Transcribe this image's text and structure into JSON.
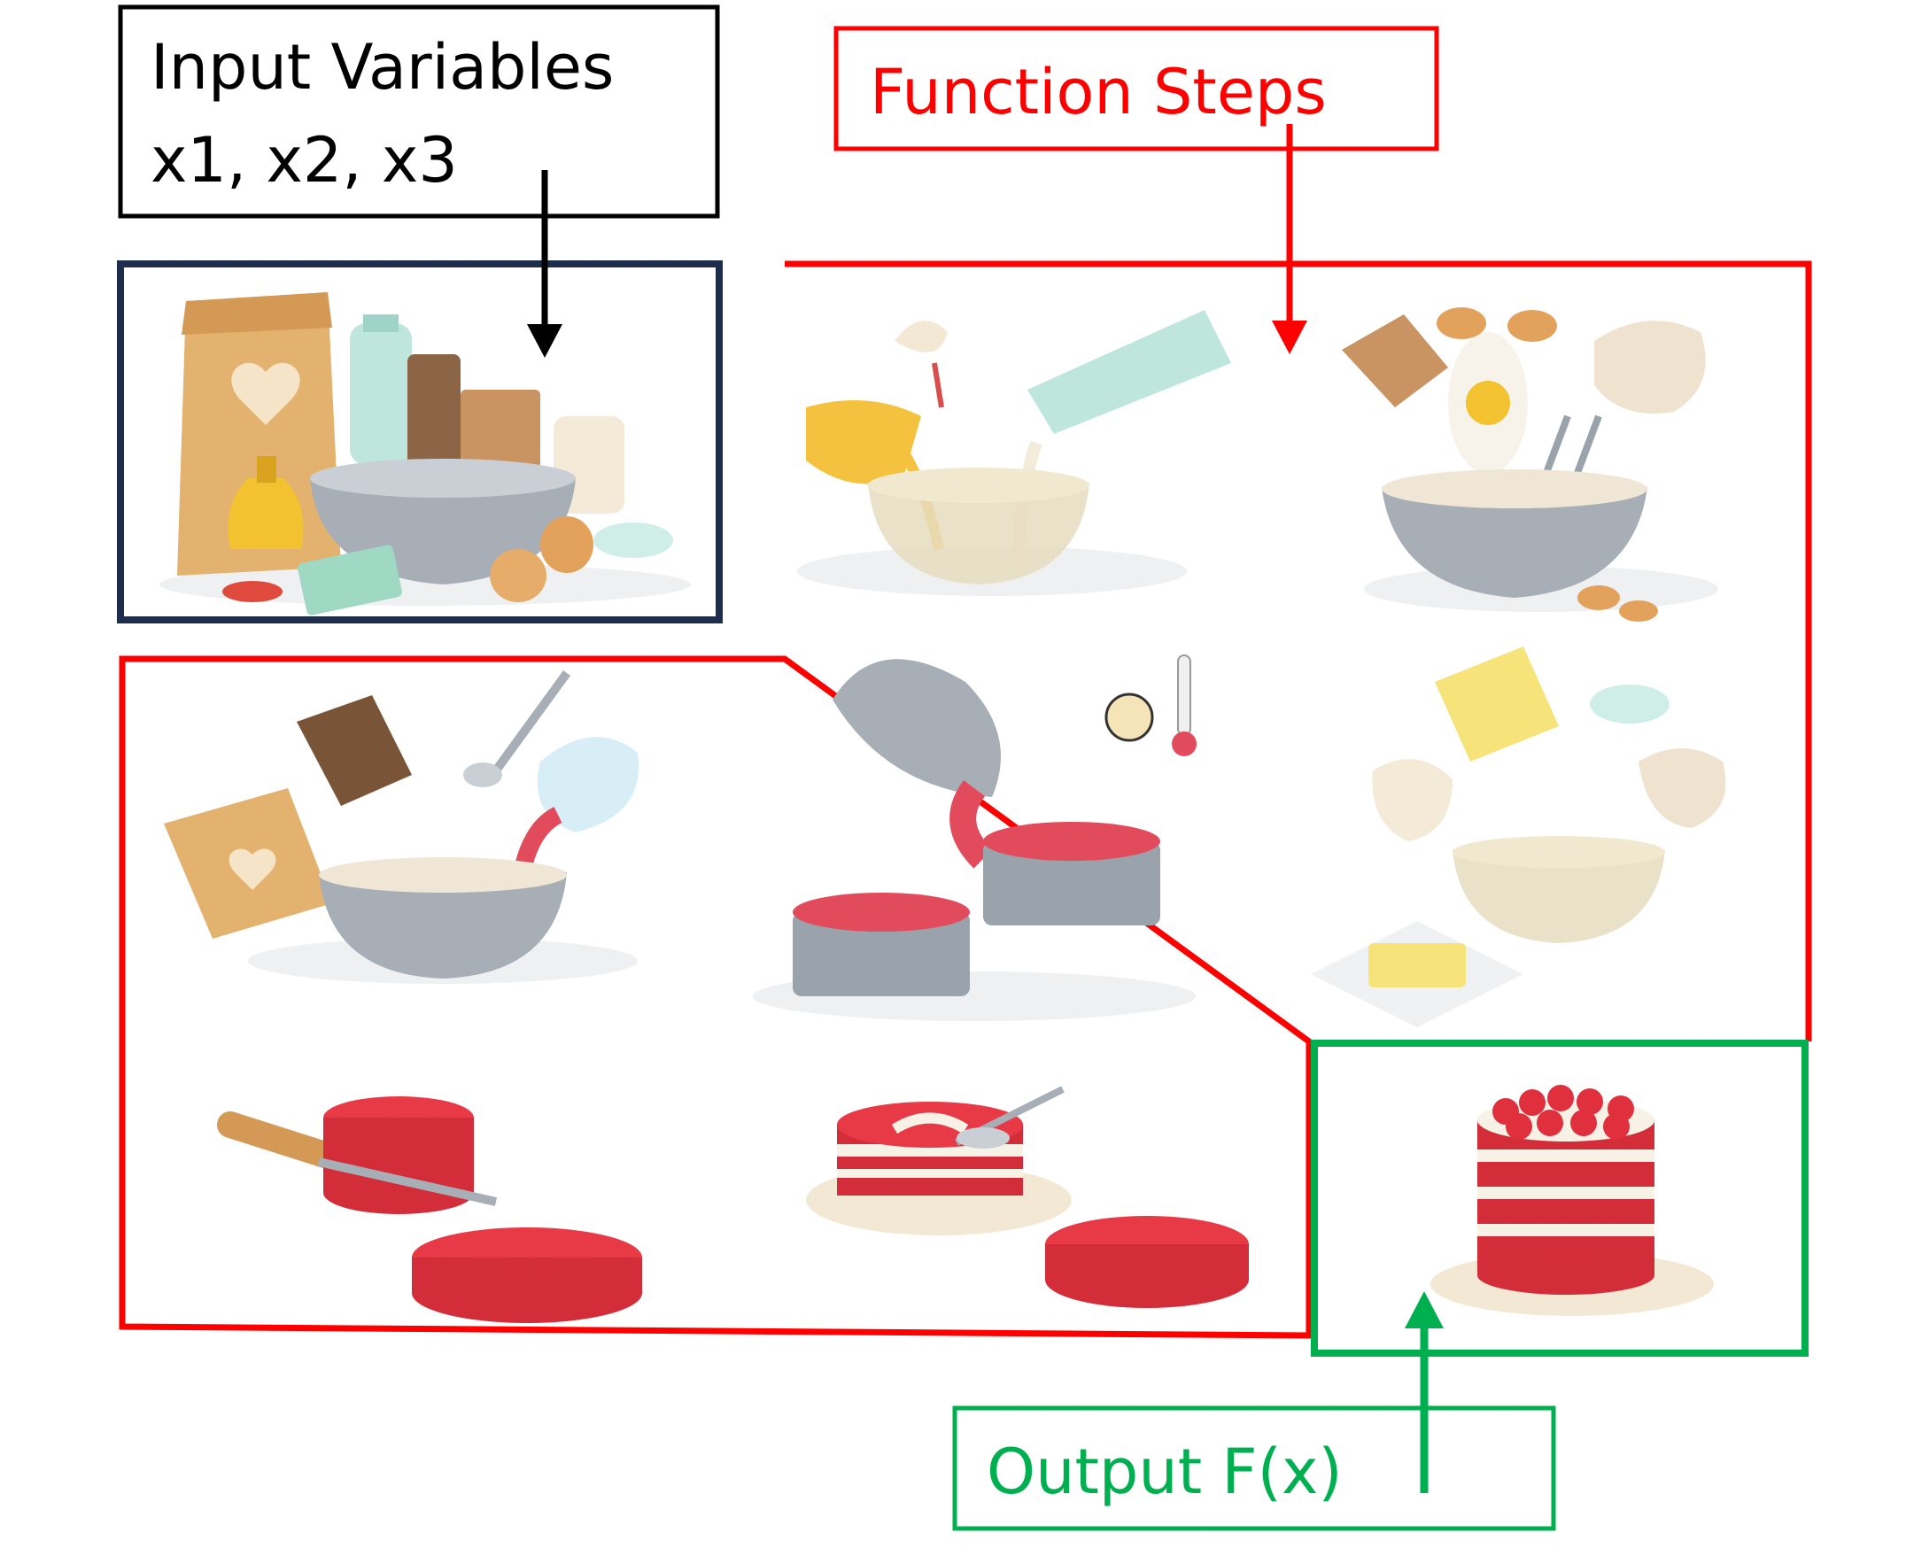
{
  "labels": {
    "input_line1": "Input Variables",
    "input_line2": "x1, x2, x3",
    "function": "Function Steps",
    "output": "Output F(x)"
  },
  "colors": {
    "input": "#000000",
    "ingredients_frame": "#1f2d4d",
    "function": "#ff0000",
    "output": "#00b050"
  },
  "icons": [
    "ingredients-illustration",
    "mix-liquids-illustration",
    "eggs-mixer-illustration",
    "add-dry-ingredients-illustration",
    "pour-into-pans-illustration",
    "butter-milk-mixer-illustration",
    "slice-cake-layers-illustration",
    "frost-layers-illustration",
    "red-velvet-cake-illustration"
  ]
}
